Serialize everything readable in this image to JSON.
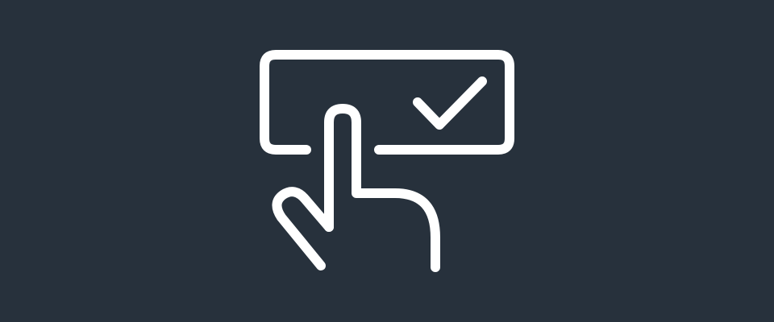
{
  "colors": {
    "background": "#27313c",
    "foreground": "#ffffff"
  },
  "illustration": {
    "icons": [
      "button-outline-icon",
      "checkmark-icon",
      "pointing-hand-icon"
    ]
  }
}
